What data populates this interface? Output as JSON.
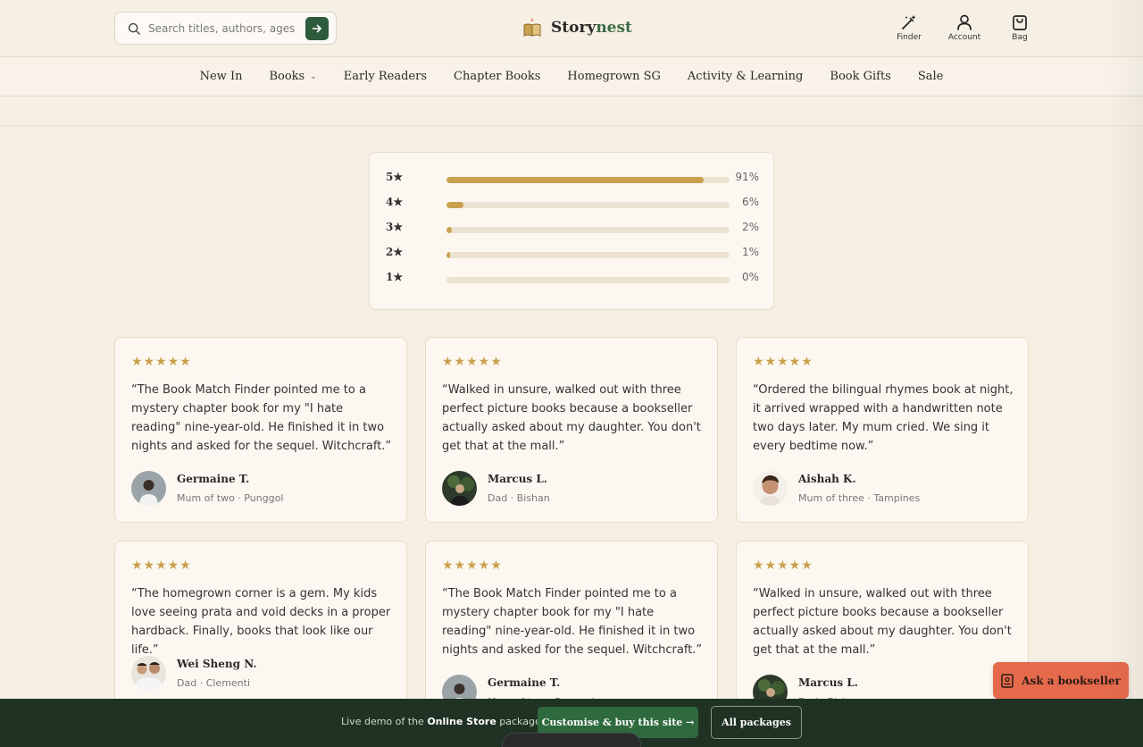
{
  "header": {
    "search_placeholder": "Search titles, authors, ages.",
    "brand": {
      "part1": "Story",
      "part2": "nest"
    },
    "icons": [
      {
        "label": "Finder",
        "icon": "magic-wand-icon"
      },
      {
        "label": "Account",
        "icon": "user-icon"
      },
      {
        "label": "Bag",
        "icon": "bag-icon"
      }
    ]
  },
  "nav": {
    "items": [
      "New In",
      "Books",
      "Early Readers",
      "Chapter Books",
      "Homegrown SG",
      "Activity & Learning",
      "Book Gifts",
      "Sale"
    ]
  },
  "ratings": [
    {
      "label": "5★",
      "percent": 91,
      "text": "91%"
    },
    {
      "label": "4★",
      "percent": 6,
      "text": "6%"
    },
    {
      "label": "3★",
      "percent": 2,
      "text": "2%"
    },
    {
      "label": "2★",
      "percent": 1,
      "text": "1%"
    },
    {
      "label": "1★",
      "percent": 0,
      "text": "0%"
    }
  ],
  "reviews": [
    {
      "stars": "★★★★★",
      "quote": "“The Book Match Finder pointed me to a mystery chapter book for my \"I hate reading\" nine-year-old. He finished it in two nights and asked for the sequel. Witchcraft.”",
      "author": "Germaine T.",
      "meta": "Mum of two · Punggol"
    },
    {
      "stars": "★★★★★",
      "quote": "“Walked in unsure, walked out with three perfect picture books because a bookseller actually asked about my daughter. You don't get that at the mall.”",
      "author": "Marcus L.",
      "meta": "Dad · Bishan"
    },
    {
      "stars": "★★★★★",
      "quote": "“Ordered the bilingual rhymes book at night, it arrived wrapped with a handwritten note two days later. My mum cried. We sing it every bedtime now.”",
      "author": "Aishah K.",
      "meta": "Mum of three · Tampines"
    },
    {
      "stars": "★★★★★",
      "quote": "“The homegrown corner is a gem. My kids love seeing prata and void decks in a proper hardback. Finally, books that look like our life.”",
      "author": "Wei Sheng N.",
      "meta": "Dad · Clementi"
    },
    {
      "stars": "★★★★★",
      "quote": "“The Book Match Finder pointed me to a mystery chapter book for my \"I hate reading\" nine-year-old. He finished it in two nights and asked for the sequel. Witchcraft.”",
      "author": "Germaine T.",
      "meta": "Mum of two · Punggol"
    },
    {
      "stars": "★★★★★",
      "quote": "“Walked in unsure, walked out with three perfect picture books because a bookseller actually asked about my daughter. You don't get that at the mall.”",
      "author": "Marcus L.",
      "meta": "Dad · Bishan"
    }
  ],
  "ask_button": "Ask a bookseller",
  "bottom_bar": {
    "msg_prefix": "Live demo of the ",
    "msg_bold": "Online Store",
    "msg_suffix": " package.",
    "primary": "Customise & buy this site →",
    "secondary": "All packages"
  },
  "colors": {
    "accent_green": "#2f5b3d",
    "gold": "#c9a14e",
    "coral": "#e56a4c",
    "dark_bar": "#1f3223"
  }
}
